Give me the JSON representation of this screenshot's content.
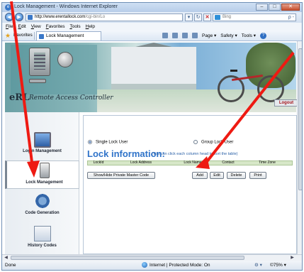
{
  "window": {
    "title": "Lock Management - Windows Internet Explorer",
    "controls": [
      "–",
      "□",
      "✕"
    ]
  },
  "address": {
    "back": "◀",
    "forward": "▶",
    "url_host": "http://www.erentallock.com",
    "url_path": "/cgi-bin/Lo",
    "dropdown": "▾",
    "refresh": "↻",
    "stop": "✕",
    "search_placeholder": "Bing",
    "search_go": "ρ -"
  },
  "menu": [
    "File",
    "Edit",
    "View",
    "Favorites",
    "Tools",
    "Help"
  ],
  "favorites": {
    "label": "Favorites",
    "tab_title": "Lock Management",
    "commands": [
      "Page ▾",
      "Safety ▾",
      "Tools ▾"
    ]
  },
  "banner": {
    "brand": "eRL",
    "brand_script": "Remote Access Controller"
  },
  "sidebar": {
    "items": [
      {
        "label": "Login Management",
        "icon": "monitor-icon"
      },
      {
        "label": "Lock Management",
        "icon": "lock-icon"
      },
      {
        "label": "Code Generation",
        "icon": "gears-icon"
      },
      {
        "label": "History Codes",
        "icon": "history-icon"
      }
    ]
  },
  "main": {
    "logout": "Logout",
    "radio_single": "Single Lock User",
    "radio_group": "Group Lock User",
    "heading": "Lock information:",
    "hint": "(You can click each column head to sort the table)",
    "columns": [
      "LockId",
      "Lock Address",
      "Lock Name",
      "Contact",
      "Time Zone"
    ],
    "buttons": {
      "showhide": "Show/Hide Private Master Code",
      "add": "Add",
      "edit": "Edit",
      "delete": "Delete",
      "print": "Print"
    }
  },
  "status": {
    "left": "Done",
    "zone": "Internet | Protected Mode: On",
    "tools": "⚙ ▾",
    "zoom": "©75% ▾"
  },
  "colors": {
    "accent": "#2f73c9",
    "arrow": "#ee1a12"
  }
}
